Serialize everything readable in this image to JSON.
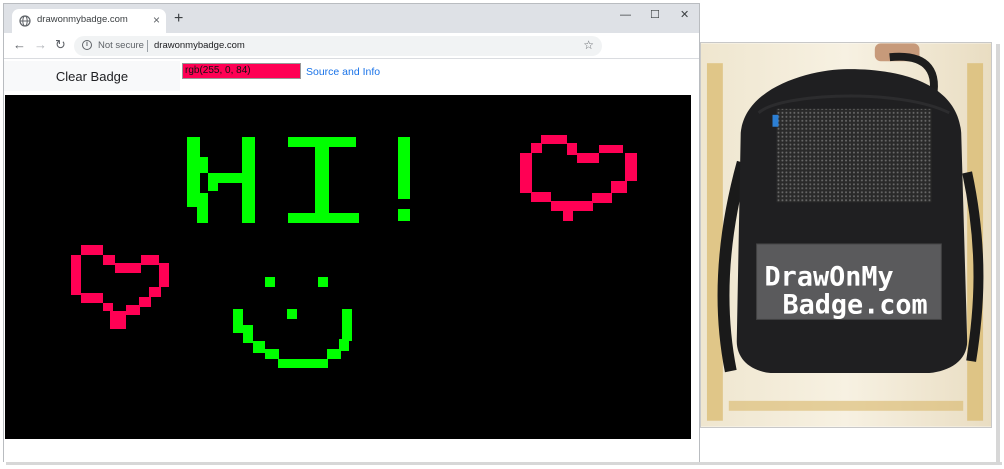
{
  "browser": {
    "tab_title": "drawonmybadge.com",
    "tab_close": "×",
    "new_tab": "+",
    "window_controls": {
      "minimize": "—",
      "maximize": "☐",
      "close": "✕"
    },
    "nav": {
      "back": "←",
      "forward": "→",
      "reload": "↻"
    },
    "security_text": "Not secure",
    "url": "drawonmybadge.com",
    "bookmark_star": "☆"
  },
  "page": {
    "clear_label": "Clear Badge",
    "color_value": "rgb(255, 0, 84)",
    "source_link": "Source and Info"
  },
  "canvas": {
    "background": "#000000",
    "drawings": [
      {
        "name": "hi-text",
        "color": "#00ff00",
        "text": "HI!"
      },
      {
        "name": "heart-large",
        "color": "#ff0054"
      },
      {
        "name": "heart-small",
        "color": "#ff0054"
      },
      {
        "name": "smiley-face",
        "color": "#00ff00"
      }
    ]
  },
  "photo": {
    "sign_text_line1": "DrawOnMy",
    "sign_text_line2": "Badge.com"
  },
  "colors": {
    "accent_red": "#ff0054",
    "accent_green": "#00ff00",
    "link_blue": "#1a73e8"
  }
}
